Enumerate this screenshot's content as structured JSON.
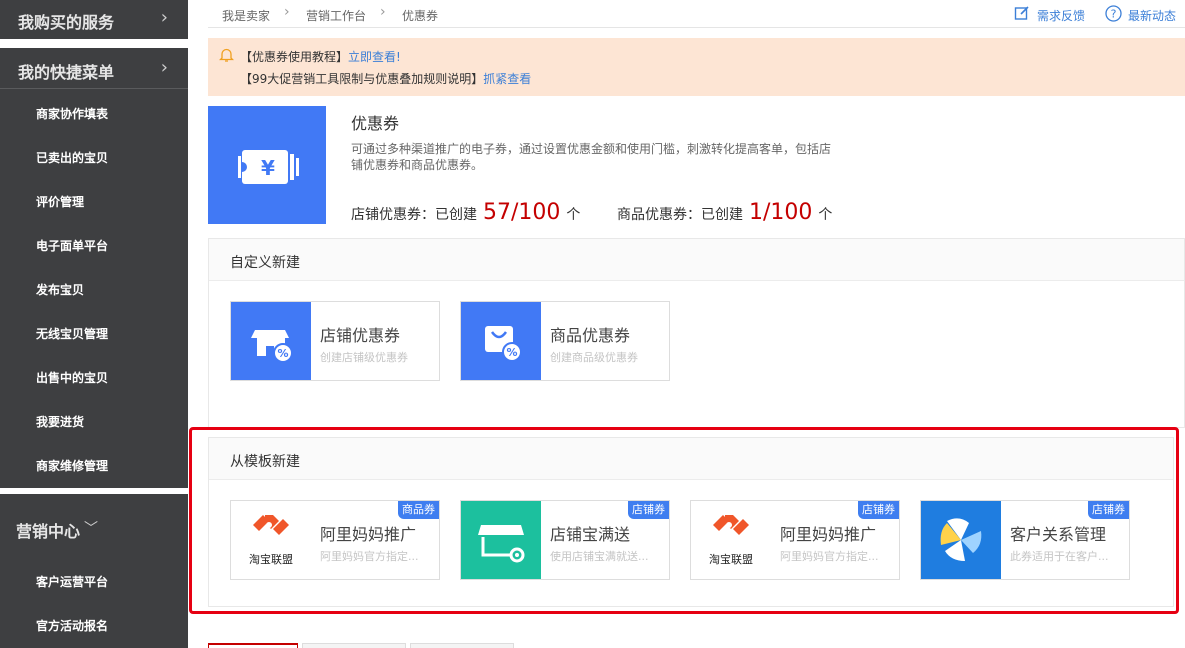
{
  "sidebar": {
    "purchased_services": "我购买的服务",
    "quick_menu": "我的快捷菜单",
    "quick_items": [
      "商家协作填表",
      "已卖出的宝贝",
      "评价管理",
      "电子面单平台",
      "发布宝贝",
      "无线宝贝管理",
      "出售中的宝贝",
      "我要进货",
      "商家维修管理"
    ],
    "marketing_center": "营销中心",
    "marketing_items": [
      "客户运营平台",
      "官方活动报名"
    ]
  },
  "breadcrumb": [
    "我是卖家",
    "营销工作台",
    "优惠券"
  ],
  "top_links": {
    "feedback": "需求反馈",
    "news": "最新动态"
  },
  "notice": {
    "line1_text": "【优惠券使用教程】",
    "line1_link": "立即查看!",
    "line2_text": "【99大促营销工具限制与优惠叠加规则说明】",
    "line2_link": "抓紧查看"
  },
  "coupon": {
    "title": "优惠券",
    "description": "可通过多种渠道推广的电子券，通过设置优惠金额和使用门槛，刺激转化提高客单，包括店铺优惠券和商品优惠券。",
    "shop_label": "店铺优惠券：已创建",
    "shop_count": "57/100",
    "item_label": "商品优惠券：已创建",
    "item_count": "1/100",
    "unit": "个"
  },
  "custom_section": {
    "title": "自定义新建",
    "cards": [
      {
        "title": "店铺优惠券",
        "subtitle": "创建店铺级优惠券"
      },
      {
        "title": "商品优惠券",
        "subtitle": "创建商品级优惠券"
      }
    ]
  },
  "template_section": {
    "title": "从模板新建",
    "cards": [
      {
        "title": "阿里妈妈推广",
        "subtitle": "阿里妈妈官方指定...",
        "badge": "商品券",
        "logo_text": "淘宝联盟"
      },
      {
        "title": "店铺宝满送",
        "subtitle": "使用店铺宝满就送...",
        "badge": "店铺券"
      },
      {
        "title": "阿里妈妈推广",
        "subtitle": "阿里妈妈官方指定...",
        "badge": "店铺券",
        "logo_text": "淘宝联盟"
      },
      {
        "title": "客户关系管理",
        "subtitle": "此券适用于在客户...",
        "badge": "店铺券"
      }
    ]
  },
  "colors": {
    "accent": "#4179f5",
    "highlight": "#e60012",
    "count": "#c40000",
    "sidebar": "#3e3f41",
    "notice_bg": "#fde5d4"
  },
  "icons": [
    "chevron-right-icon",
    "chevron-down-icon",
    "bell-icon",
    "edit-icon",
    "help-icon",
    "coupon-ticket-icon",
    "shop-percent-icon",
    "bag-percent-icon",
    "taobao-union-logo",
    "shop-gear-icon",
    "crm-pinwheel-icon"
  ]
}
